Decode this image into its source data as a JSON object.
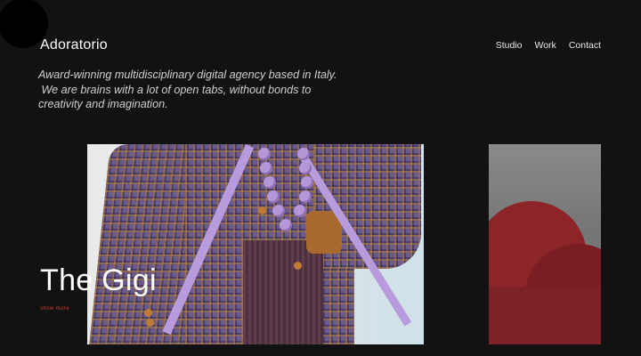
{
  "header": {
    "logo": "Adoratorio",
    "nav": [
      {
        "label": "Studio"
      },
      {
        "label": "Work"
      },
      {
        "label": "Contact"
      }
    ]
  },
  "intro": {
    "line1": "Award-winning multidisciplinary digital agency based in Italy.",
    "line2": " We are brains with a lot of open tabs, without bonds to",
    "line3": "creativity and imagination."
  },
  "project": {
    "title": "The Gigi",
    "show_more": "show more"
  },
  "colors": {
    "background": "#121212",
    "accent": "#d33a2c",
    "text": "#ffffff"
  }
}
